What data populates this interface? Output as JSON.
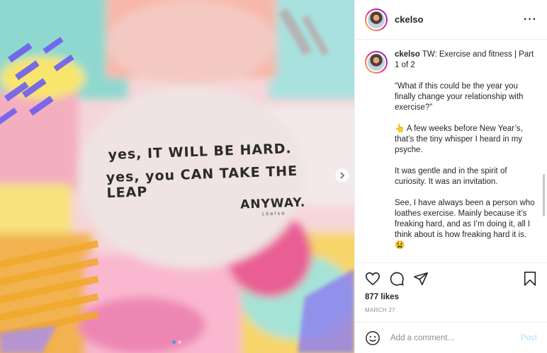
{
  "post": {
    "artwork": {
      "line1": "yes, IT WILL BE HARD.",
      "line2": "yes, you CAN TAKE THE LEAP",
      "line3": "ANYWAY.",
      "signature": "ckelso"
    },
    "carousel": {
      "total": 2,
      "current": 1
    }
  },
  "header": {
    "username": "ckelso",
    "more_icon": "more-horizontal-icon"
  },
  "caption": {
    "username": "ckelso",
    "title": "TW: Exercise and fitness | Part 1 of 2",
    "paragraphs": [
      "“What if this could be the year you finally change your relationship with exercise?”",
      "👆 A few weeks before New Year’s, that’s the tiny whisper I heard in my psyche.",
      "It was gentle and in the spirit of curiosity. It was an invitation.",
      "See, I have always been a person who loathes exercise. Mainly because it’s freaking hard, and as I’m doing it, all I think about is how freaking hard it is. 😫"
    ]
  },
  "actions": {
    "likes": "877 likes",
    "date": "MARCH 27",
    "icons": [
      "heart-icon",
      "comment-icon",
      "share-icon",
      "bookmark-icon"
    ]
  },
  "comment_box": {
    "placeholder": "Add a comment...",
    "post_label": "Post",
    "post_color": "#b2dffc"
  }
}
